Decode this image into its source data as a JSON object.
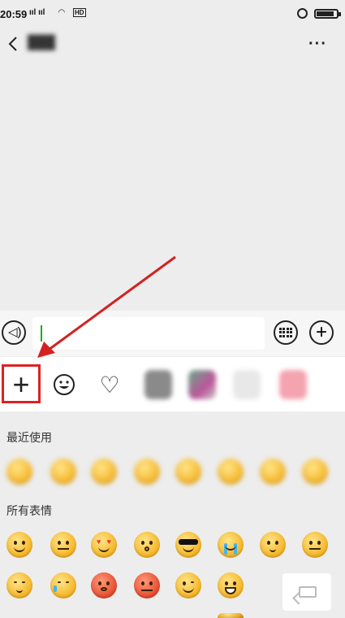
{
  "status_bar": {
    "time": "20:59",
    "signal_text": "ııl ııl",
    "network": "HD"
  },
  "title_bar": {
    "chat_name": "███",
    "more_label": "···"
  },
  "input_row": {
    "voice_glyph": "◁)",
    "plus_glyph": "+"
  },
  "tabs": {
    "add_glyph": "+",
    "heart_glyph": "♡"
  },
  "emoji_panel": {
    "recent_label": "最近使用",
    "all_label": "所有表情"
  },
  "annotation": {
    "color": "#d22222"
  }
}
